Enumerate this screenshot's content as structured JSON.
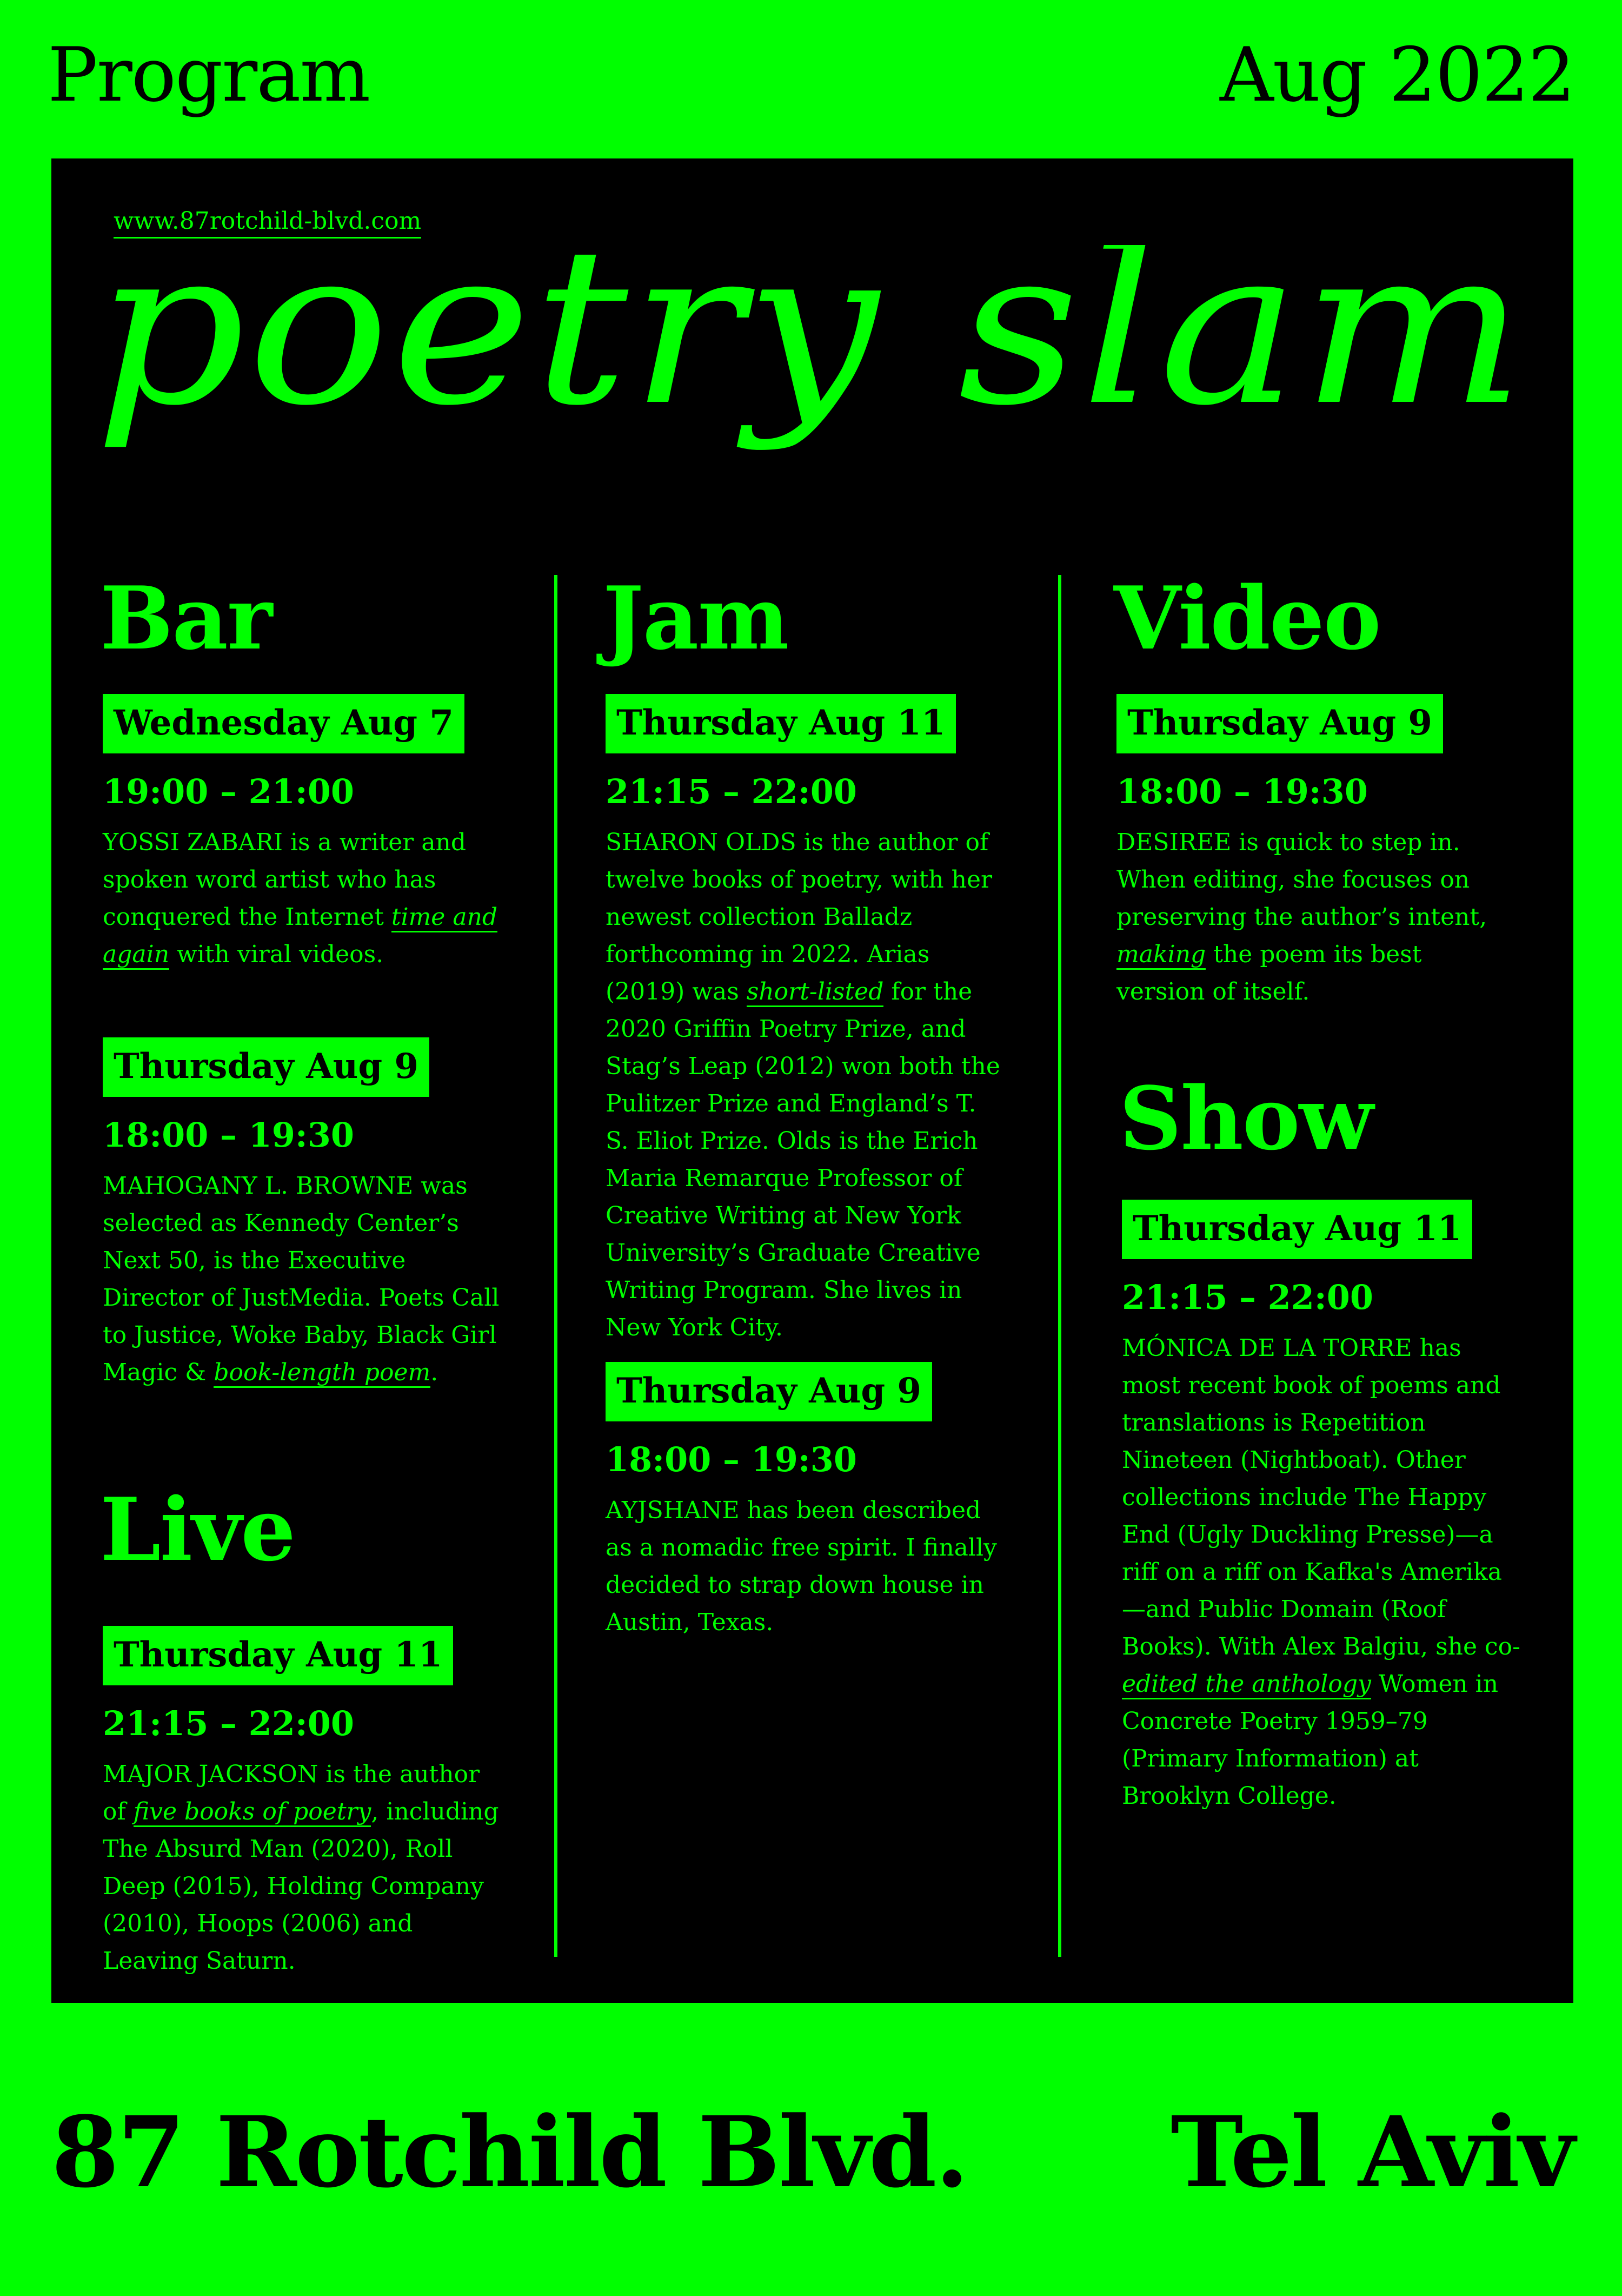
{
  "header": {
    "program": "Program",
    "date": "Aug 2022"
  },
  "panel": {
    "url": "www.87rotchild-blvd.com",
    "title": "poetry slam"
  },
  "bar": {
    "heading": "Bar",
    "events": [
      {
        "date": "Wednesday Aug 7",
        "time": "19:00 – 21:00",
        "desc_pre": "YOSSI ZABARI is a writer and spoken word artist who has conquered the Internet ",
        "desc_link": "time and again",
        "desc_post": " with viral videos."
      },
      {
        "date": "Thursday Aug 9",
        "time": "18:00 – 19:30",
        "desc_pre": "MAHOGANY L. BROWNE was selected as Kennedy Center’s Next 50, is the Executive Director of JustMedia. Poets Call to Justice, Woke Baby, Black Girl Magic & ",
        "desc_link": "book-length poem",
        "desc_post": "."
      }
    ]
  },
  "live": {
    "heading": "Live",
    "events": [
      {
        "date": "Thursday Aug 11",
        "time": "21:15 – 22:00",
        "desc_pre": "MAJOR JACKSON is the author of ",
        "desc_link": "five books of poetry",
        "desc_post": ", including The Absurd Man (2020), Roll Deep (2015), Holding Company (2010), Hoops (2006) and Leaving Saturn."
      }
    ]
  },
  "jam": {
    "heading": "Jam",
    "events": [
      {
        "date": "Thursday Aug 11",
        "time": "21:15 – 22:00",
        "desc_pre": "SHARON OLDS is the author of twelve books of poetry, with her newest collection Balladz forthcoming in 2022. Arias (2019) was ",
        "desc_link": "short-listed",
        "desc_post": " for the 2020 Griffin Poetry Prize, and Stag’s Leap (2012) won both the Pulitzer Prize and England’s T. S. Eliot Prize. Olds is the Erich Maria Remarque Professor of Creative Writing at New York University’s Graduate Creative Writing Program. She lives in New York City."
      },
      {
        "date": "Thursday Aug 9",
        "time": "18:00 – 19:30",
        "desc_pre": "AYJSHANE has been described as a nomadic free spirit. I finally decided to strap down house in Austin, Texas.",
        "desc_link": "",
        "desc_post": ""
      }
    ]
  },
  "video": {
    "heading": "Video",
    "events": [
      {
        "date": "Thursday Aug 9",
        "time": "18:00 – 19:30",
        "desc_pre": "DESIREE is quick to step in. When editing, she focuses on preserving the author’s intent, ",
        "desc_link": "making",
        "desc_post": " the poem its best version of itself."
      }
    ]
  },
  "show": {
    "heading": "Show",
    "events": [
      {
        "date": "Thursday Aug 11",
        "time": "21:15 – 22:00",
        "desc_pre": "MÓNICA DE LA TORRE has most recent book of poems and translations is Repetition Nineteen (Nightboat). Other collections include The Happy End (Ugly Duckling Presse)—a riff on a riff on Kafka's Amerika—and Public Domain (Roof Books). With Alex Balgiu, she co-",
        "desc_link": "edited the anthology",
        "desc_post": " Women in Concrete Poetry 1959–79 (Primary Information) at Brooklyn College."
      }
    ]
  },
  "footer": {
    "address": "87 Rotchild Blvd.",
    "city": "Tel Aviv"
  },
  "colors": {
    "accent": "#00ff00",
    "panel": "#000000"
  }
}
